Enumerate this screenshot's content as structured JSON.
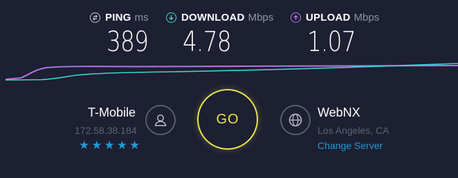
{
  "metrics": {
    "ping": {
      "label": "PING",
      "unit": "ms",
      "value": "389",
      "color": "#c9cbd8",
      "icon": "ping-icon"
    },
    "download": {
      "label": "DOWNLOAD",
      "unit": "Mbps",
      "value": "4.78",
      "color": "#3fe0cf",
      "icon": "download-arrow-icon"
    },
    "upload": {
      "label": "UPLOAD",
      "unit": "Mbps",
      "value": "1.07",
      "color": "#b77bf4",
      "icon": "upload-arrow-icon"
    }
  },
  "isp": {
    "name": "T-Mobile",
    "ip": "172.58.38.184",
    "rating": 5,
    "icon": "user-icon"
  },
  "go_button": {
    "label": "GO",
    "color": "#e9e64e"
  },
  "server": {
    "name": "WebNX",
    "location": "Los Angeles, CA",
    "change_label": "Change Server",
    "icon": "globe-icon"
  },
  "colors": {
    "background": "#1d1f32",
    "accent_blue": "#1e9bd7",
    "muted_text": "#5f6277"
  }
}
